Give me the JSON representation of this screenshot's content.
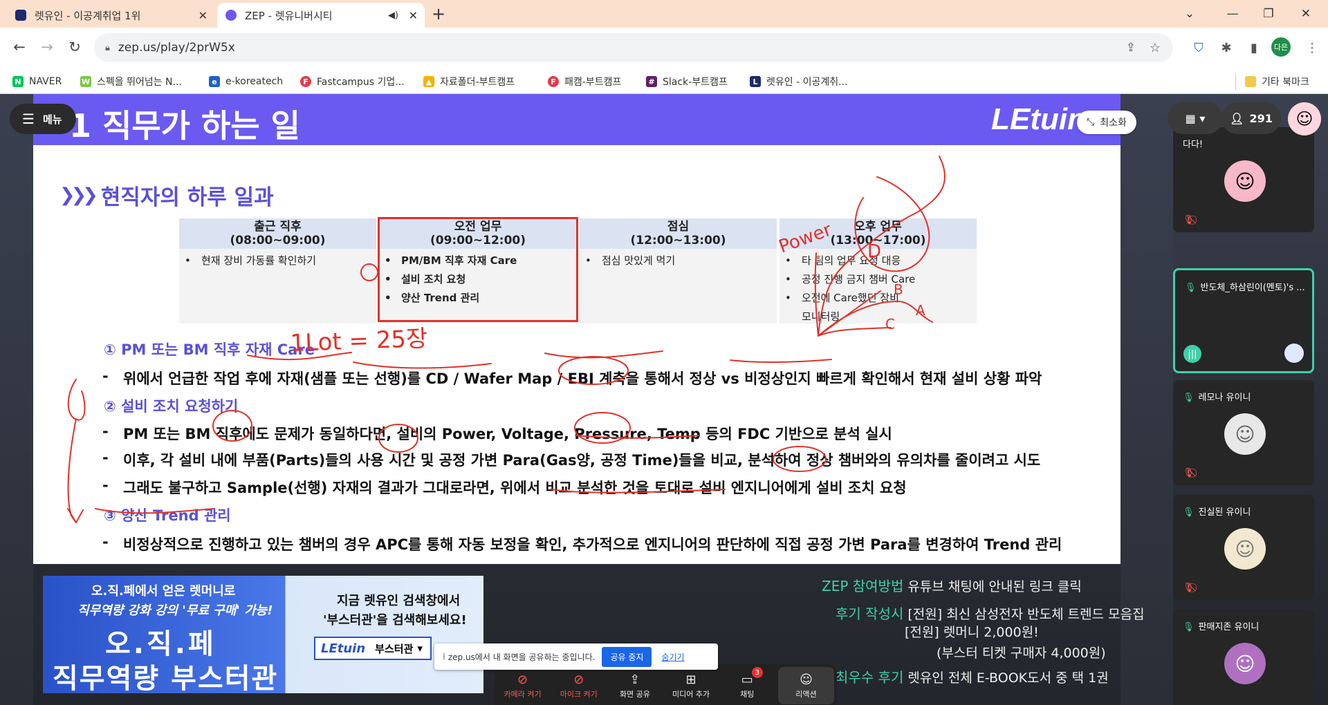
{
  "tabs": [
    {
      "title": "렛유인 - 이공계취업 1위",
      "active": false
    },
    {
      "title": "ZEP - 렛유니버시티",
      "active": true
    }
  ],
  "address": {
    "url": "zep.us/play/2prW5x"
  },
  "profile": {
    "initials": "다은"
  },
  "bookmarks": [
    {
      "label": "NAVER",
      "icon": "N",
      "color": "#03c75a"
    },
    {
      "label": "스펙을 뛰어넘는 N...",
      "icon": "W",
      "color": "#7ac943"
    },
    {
      "label": "e-koreatech",
      "icon": "e",
      "color": "#1e63c8"
    },
    {
      "label": "Fastcampus 기업...",
      "icon": "F",
      "color": "#e23a4a"
    },
    {
      "label": "자료폴더-부트캠프",
      "icon": "▲",
      "color": "#f4b400"
    },
    {
      "label": "패캠-부트캠프",
      "icon": "F",
      "color": "#e23a4a"
    },
    {
      "label": "Slack-부트캠프",
      "icon": "#",
      "color": "#611f69"
    },
    {
      "label": "렛유인 - 이공계취...",
      "icon": "L",
      "color": "#1d2a70"
    }
  ],
  "bookmarks_other": "기타 북마크",
  "overlay": {
    "menu_label": "메뉴",
    "minimize_label": "최소화",
    "participants": "291"
  },
  "slide": {
    "header_title": "1 직무가 하는 일",
    "brand": "LEtuin",
    "section_title": "현직자의 하루 일과",
    "schedule": [
      {
        "title": "출근 직후",
        "time": "(08:00~09:00)",
        "items": [
          "현재 장비 가동률 확인하기"
        ]
      },
      {
        "title": "오전 업무",
        "time": "(09:00~12:00)",
        "items": [
          "PM/BM 직후 자재 Care",
          "설비 조치 요청",
          "양산 Trend 관리"
        ]
      },
      {
        "title": "점심",
        "time": "(12:00~13:00)",
        "items": [
          "점심 맛있게 먹기"
        ]
      },
      {
        "title": "오후 업무",
        "time": "(13:00~17:00)",
        "items": [
          "타 팀의 업무 요청 대응",
          "공정 진행 금지 챔버 Care",
          "오전에 Care했던 장비",
          "모니터링"
        ]
      }
    ],
    "points": [
      {
        "label": "① PM 또는 BM 직후 자재 Care",
        "lines": [
          "위에서 언급한 작업 후에 자재(샘플 또는 선행)를  CD / Wafer Map / EBI 계측을 통해서 정상 vs 비정상인지 빠르게 확인해서 현재 설비 상황 파악"
        ]
      },
      {
        "label": "② 설비 조치 요청하기",
        "lines": [
          "PM 또는 BM 직후에도 문제가 동일하다면, 설비의 Power, Voltage, Pressure, Temp 등의 FDC 기반으로 분석 실시",
          "이후, 각 설비 내에 부품(Parts)들의 사용 시간 및 공정 가변 Para(Gas양, 공정 Time)들을 비교, 분석하여 정상 챔버와의 유의차를 줄이려고 시도",
          "그래도 불구하고 Sample(선행) 자재의 결과가 그대로라면, 위에서 비교 분석한 것을 토대로 설비 엔지니어에게 설비 조치 요청"
        ]
      },
      {
        "label": "③ 양산 Trend 관리",
        "lines": [
          "비정상적으로 진행하고 있는 챔버의 경우 APC를 통해 자동 보정을 확인, 추가적으로 엔지니어의 판단하에 직접 공정 가변 Para를 변경하여 Trend 관리"
        ]
      }
    ],
    "annotations": {
      "lot": "1Lot = 25장",
      "power": "Power",
      "d": "D",
      "b": "B",
      "a": "A",
      "c": "C"
    }
  },
  "banner": {
    "line1": "오.직.페에서 얻은 렛머니로",
    "line2": "직무역량 강화 강의 '무료 구매' 가능!",
    "line3": "오.직.페",
    "line4": "직무역량 부스터관",
    "right1": "지금 렛유인 검색창에서",
    "right2": "'부스터관'을 검색해보세요!",
    "search_logo": "LEtuin",
    "search_text": "부스터관"
  },
  "promo": [
    {
      "green": "ZEP 참여방법",
      "text": " 유튜브 채팅에 안내된 링크 클릭"
    },
    {
      "green": "후기 작성시",
      "text": " [전원] 최신 삼성전자 반도체 트렌드 모음집"
    },
    {
      "green": "",
      "text": "[전원] 렛머니 2,000원!"
    },
    {
      "green": "",
      "text": "(부스터 티켓 구매자 4,000원)"
    },
    {
      "green": "최우수 후기",
      "text": " 렛유인 전체 E-BOOK도서 중 택 1권"
    }
  ],
  "share_bar": {
    "text": "zep.us에서 내 화면을 공유하는 중입니다.",
    "stop": "공유 중지",
    "hide": "숨기기"
  },
  "dock": [
    {
      "label": "카메라 켜기",
      "icon": "⊘",
      "red": true
    },
    {
      "label": "마이크 켜기",
      "icon": "⊘",
      "red": true
    },
    {
      "label": "화면 공유",
      "icon": "⇪",
      "red": false
    },
    {
      "label": "미디어 추가",
      "icon": "⊞",
      "red": false
    },
    {
      "label": "채팅",
      "icon": "▭",
      "red": false,
      "badge": "3"
    },
    {
      "label": "리액션",
      "icon": "☺",
      "red": false
    }
  ],
  "video_cards": [
    {
      "name": "다다!",
      "speaking": false,
      "muted": true,
      "face": "#f7b8c8"
    },
    {
      "name": "반도체_하삼린이(멘토)'s ...",
      "speaking": true,
      "muted": false,
      "face": ""
    },
    {
      "name": "레모나 유이니",
      "speaking": false,
      "muted": true,
      "face": "#e8e8e8"
    },
    {
      "name": "진실된 유이니",
      "speaking": false,
      "muted": true,
      "face": "#f2e8d0"
    },
    {
      "name": "판매지존 유이니",
      "speaking": false,
      "muted": false,
      "face": "#b070c0"
    }
  ]
}
